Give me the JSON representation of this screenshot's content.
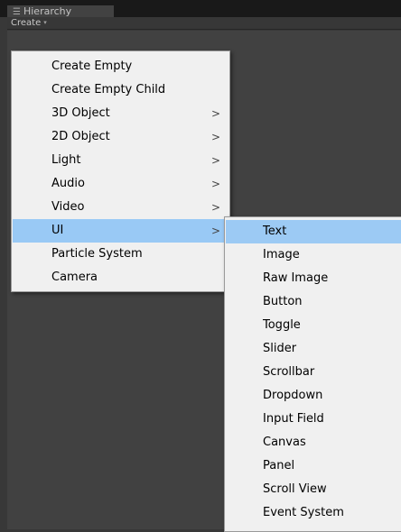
{
  "window": {
    "tab_title": "Hierarchy",
    "tab_icon": "list-icon",
    "create_label": "Create",
    "create_caret": "▾"
  },
  "main_menu": {
    "items": [
      {
        "label": "Create Empty",
        "submenu": false
      },
      {
        "label": "Create Empty Child",
        "submenu": false
      },
      {
        "label": "3D Object",
        "submenu": true
      },
      {
        "label": "2D Object",
        "submenu": true
      },
      {
        "label": "Light",
        "submenu": true
      },
      {
        "label": "Audio",
        "submenu": true
      },
      {
        "label": "Video",
        "submenu": true
      },
      {
        "label": "UI",
        "submenu": true,
        "highlighted": true
      },
      {
        "label": "Particle System",
        "submenu": false
      },
      {
        "label": "Camera",
        "submenu": false
      }
    ],
    "arrow_glyph": ">"
  },
  "ui_submenu": {
    "items": [
      {
        "label": "Text",
        "highlighted": true
      },
      {
        "label": "Image"
      },
      {
        "label": "Raw Image"
      },
      {
        "label": "Button"
      },
      {
        "label": "Toggle"
      },
      {
        "label": "Slider"
      },
      {
        "label": "Scrollbar"
      },
      {
        "label": "Dropdown"
      },
      {
        "label": "Input Field"
      },
      {
        "label": "Canvas"
      },
      {
        "label": "Panel"
      },
      {
        "label": "Scroll View"
      },
      {
        "label": "Event System"
      }
    ]
  },
  "colors": {
    "highlight": "#99c9f5",
    "menu_bg": "#f0f0f0",
    "editor_bg": "#414141"
  }
}
